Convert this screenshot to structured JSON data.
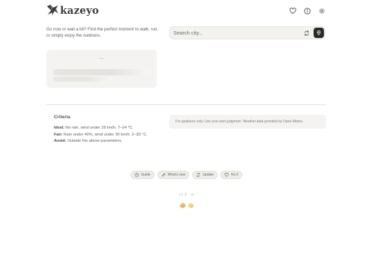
{
  "header": {
    "app_name": "kazeyo",
    "icons": [
      "heart-icon",
      "info-icon",
      "gear-icon"
    ]
  },
  "intro": {
    "text": "Go now or wait a bit? Find the perfect moment to walk, run, or simply enjoy the outdoors."
  },
  "search": {
    "placeholder": "Search city...",
    "value": ""
  },
  "weather_card": {
    "status": "—"
  },
  "criteria": {
    "title": "Criteria",
    "ideal_label": "Ideal:",
    "ideal_text": " No rain, wind under 18 km/h, 7–24 °C.",
    "fair_label": "Fair:",
    "fair_text": " Rain under 40%, wind under 30 km/h, 2–30 °C.",
    "avoid_label": "Avoid:",
    "avoid_text": " Outside the above parameters."
  },
  "note": {
    "text": "For guidance only. Use your own judgment. Weather data provided by Open-Meteo."
  },
  "chips": {
    "guide": "Guide",
    "whats_new": "What's new",
    "update": "Update",
    "kofi": "Ko-fi"
  },
  "footer": {
    "version": "v1.3 · m"
  },
  "colors": {
    "accent_dark": "#2a2a2a",
    "card_bg": "#f4f3f1",
    "chip_bg": "#eeedea"
  }
}
